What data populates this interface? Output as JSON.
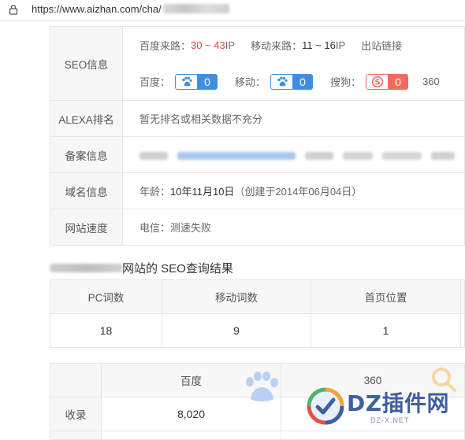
{
  "browser": {
    "url_prefix": "https://www.aizhan.com/cha/"
  },
  "info_table": {
    "seo": {
      "label": "SEO信息",
      "baidu_traffic_label": "百度来路：",
      "baidu_traffic": "30 ~ 43",
      "ip_unit": " IP",
      "mobile_traffic_label": "移动来路：",
      "mobile_traffic": "11 ~ 16",
      "outlinks_label": "出站链接",
      "baidu_label": "百度：",
      "baidu_weight": "0",
      "mobile_label": "移动：",
      "mobile_weight": "0",
      "sogou_label": "搜狗：",
      "sogou_weight": "0",
      "so360_label": "360"
    },
    "alexa": {
      "label": "ALEXA排名",
      "value": "暂无排名或相关数据不充分"
    },
    "icp": {
      "label": "备案信息"
    },
    "domain": {
      "label": "域名信息",
      "age_label": "年龄：",
      "age": "10年11月10日",
      "created": "（创建于2014年06月04日）"
    },
    "speed": {
      "label": "网站速度",
      "value": "电信：测速失败"
    }
  },
  "section_title": "网站的 SEO查询结果",
  "result_table": {
    "headers": [
      "PC词数",
      "移动词数",
      "首页位置"
    ],
    "values": [
      "18",
      "9",
      "1"
    ]
  },
  "engine_table": {
    "headers": [
      "百度",
      "360"
    ],
    "row_label": "收录",
    "values": [
      "8,020",
      ""
    ]
  },
  "watermark": {
    "text": "DZ插件网",
    "sub": "DZ-X.NET"
  },
  "colors": {
    "accent_red": "#e04848",
    "badge_blue": "#3d8fe4",
    "badge_red": "#ef6b5a",
    "label_bg": "#f7f7f7",
    "border": "#e6e6e6"
  }
}
